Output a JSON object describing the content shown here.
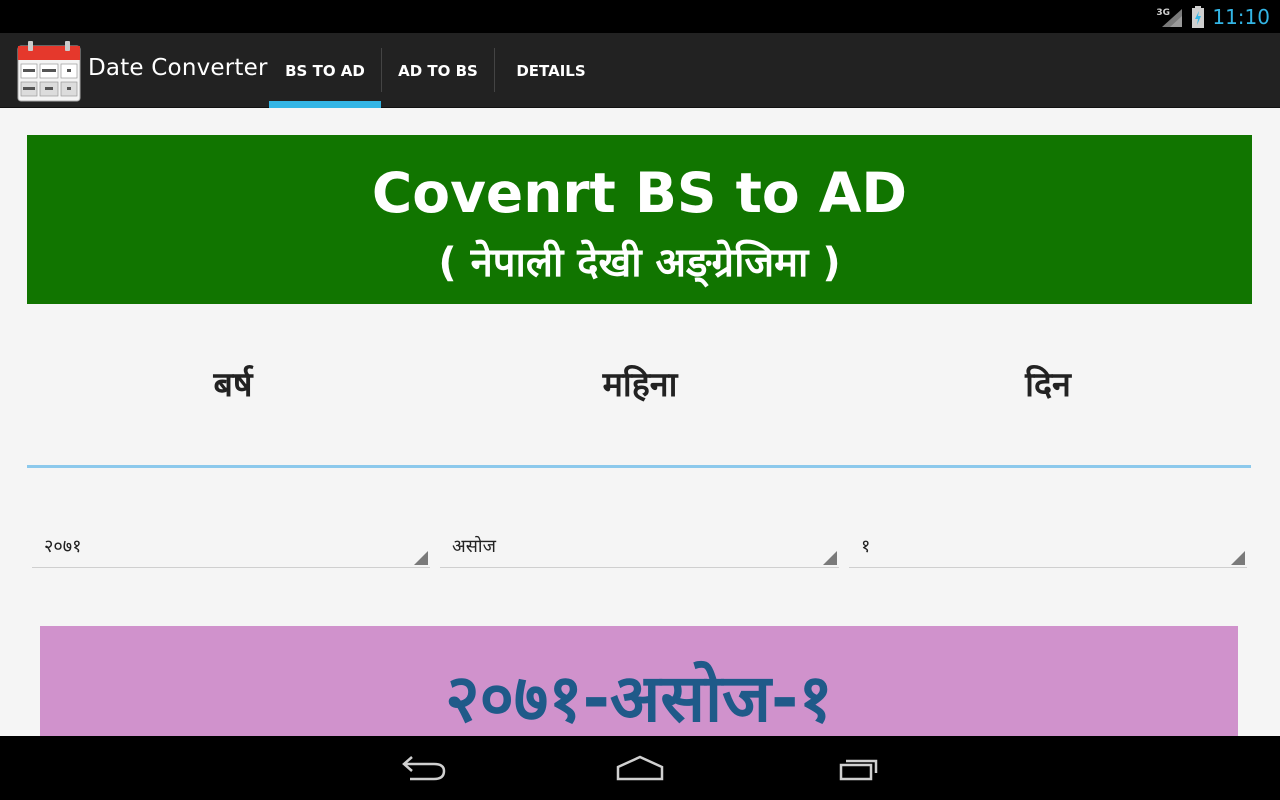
{
  "status_bar": {
    "network": "3G",
    "time": "11:10"
  },
  "action_bar": {
    "app_title": "Date Converter",
    "app_icon": "calendar-icon",
    "tabs": [
      {
        "label": "BS TO AD",
        "active": true
      },
      {
        "label": "AD TO BS",
        "active": false
      },
      {
        "label": "DETAILS",
        "active": false
      }
    ]
  },
  "header": {
    "title": "Covenrt BS to AD",
    "subtitle": "( नेपाली देखी अङ्ग्रेजिमा )",
    "background_color": "#117500"
  },
  "fields": {
    "year_label": "बर्ष",
    "month_label": "महिना",
    "day_label": "दिन"
  },
  "spinners": {
    "year_value": "२०७१",
    "month_value": "असोज",
    "day_value": "१"
  },
  "result": {
    "text": "२०७१-असोज-१",
    "background_color": "#d092cc",
    "text_color": "#1f5a89"
  },
  "nav_bar": {
    "back_icon": "back-icon",
    "home_icon": "home-icon",
    "recents_icon": "recents-icon"
  },
  "colors": {
    "accent": "#33b5e5"
  }
}
